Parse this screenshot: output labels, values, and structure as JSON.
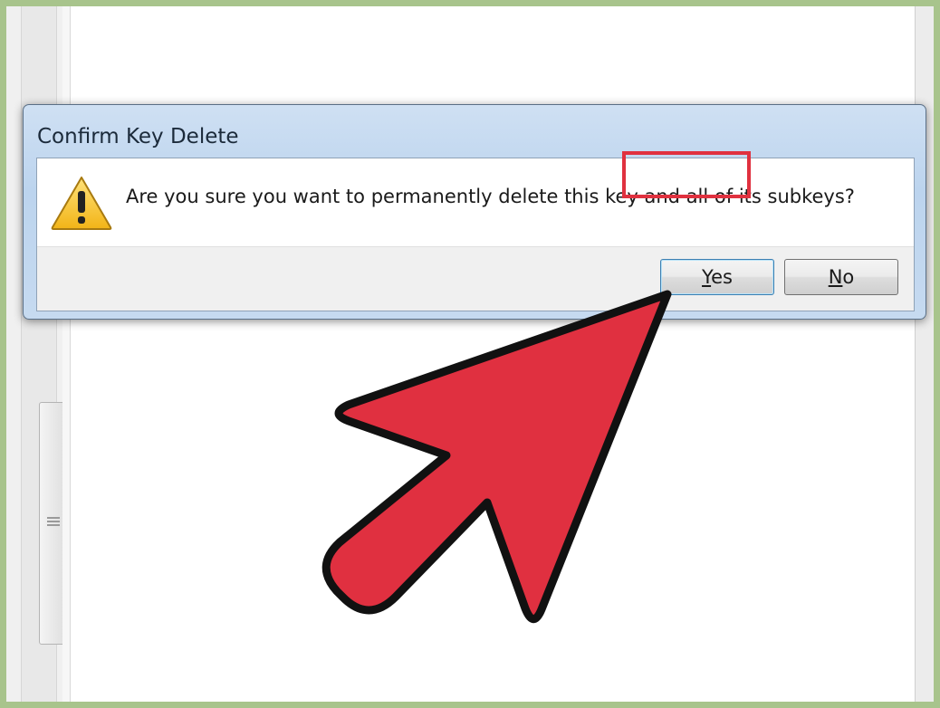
{
  "dialog": {
    "title": "Confirm Key Delete",
    "message": "Are you sure you want to permanently delete this key and all of its subkeys?",
    "icon": "warning-icon",
    "buttons": {
      "yes": {
        "accel": "Y",
        "rest": "es"
      },
      "no": {
        "accel": "N",
        "rest": "o"
      }
    }
  },
  "annotation": {
    "highlight_color": "#e0313f",
    "arrow_color": "#e03040",
    "arrow_outline": "#111111"
  },
  "window": {
    "frame_color": "#a8c48c"
  }
}
